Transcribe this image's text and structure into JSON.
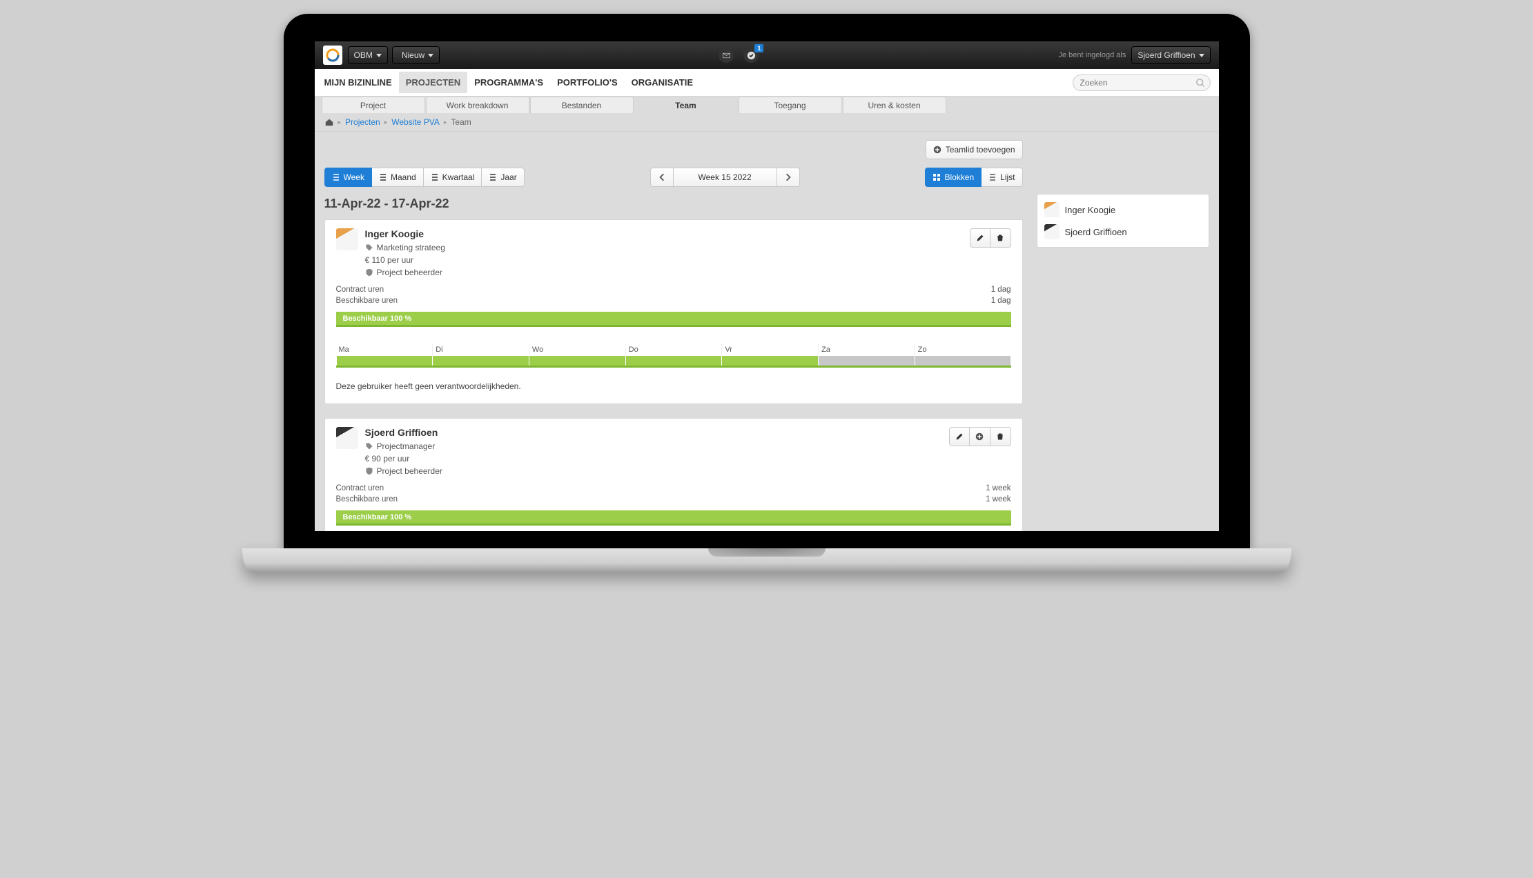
{
  "topbar": {
    "workspace": "OBM",
    "new_label": "Nieuw",
    "notification_count": "1",
    "login_text": "Je bent ingelogd als",
    "user_name": "Sjoerd Griffioen"
  },
  "mainnav": {
    "items": [
      "MIJN BIZINLINE",
      "PROJECTEN",
      "PROGRAMMA'S",
      "PORTFOLIO'S",
      "ORGANISATIE"
    ],
    "active": "PROJECTEN",
    "search_placeholder": "Zoeken"
  },
  "subtabs": {
    "items": [
      "Project",
      "Work breakdown",
      "Bestanden",
      "Team",
      "Toegang",
      "Uren & kosten"
    ],
    "active": "Team"
  },
  "breadcrumb": {
    "links": [
      "Projecten",
      "Website PVA"
    ],
    "current": "Team"
  },
  "actions": {
    "add_member": "Teamlid toevoegen"
  },
  "granularity": {
    "items": [
      "Week",
      "Maand",
      "Kwartaal",
      "Jaar"
    ],
    "active": "Week"
  },
  "period_nav": {
    "label": "Week 15 2022"
  },
  "view_toggle": {
    "blocks": "Blokken",
    "list": "Lijst",
    "active": "Blokken"
  },
  "date_range_title": "11-Apr-22 - 17-Apr-22",
  "kv_labels": {
    "contract": "Contract uren",
    "available": "Beschikbare uren"
  },
  "availability_text": "Beschikbaar 100 %",
  "weekdays": [
    "Ma",
    "Di",
    "Wo",
    "Do",
    "Vr",
    "Za",
    "Zo"
  ],
  "members": [
    {
      "name": "Inger Koogie",
      "role": "Marketing strateeg",
      "rate": "€ 110 per uur",
      "badge": "Project beheerder",
      "contract_value": "1 dag",
      "available_value": "1 dag",
      "days_green": 5,
      "note": "Deze gebruiker heeft geen verantwoordelijkheden.",
      "has_add": false
    },
    {
      "name": "Sjoerd Griffioen",
      "role": "Projectmanager",
      "rate": "€ 90 per uur",
      "badge": "Project beheerder",
      "contract_value": "1 week",
      "available_value": "1 week",
      "days_green": 5,
      "note": "",
      "has_add": true
    }
  ],
  "side_members": [
    "Inger Koogie",
    "Sjoerd Griffioen"
  ]
}
